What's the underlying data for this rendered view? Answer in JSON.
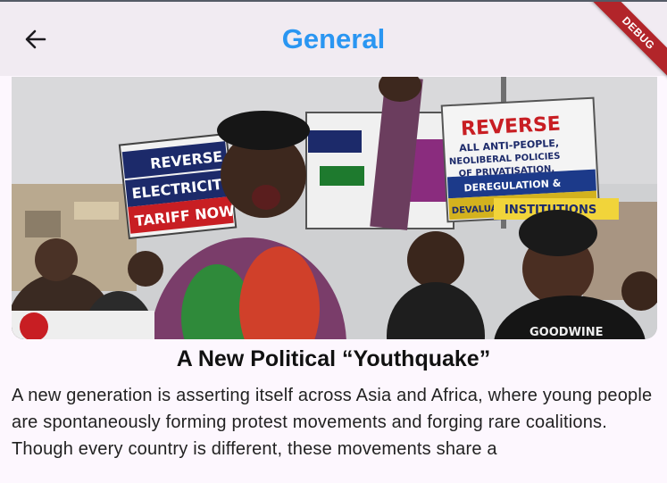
{
  "appbar": {
    "title": "General",
    "back_icon": "arrow-back-icon",
    "debug_label": "DEBUG"
  },
  "hero": {
    "signs": {
      "left": [
        "REVERSE",
        "ELECTRICITY",
        "TARIFF NOW"
      ],
      "right": [
        "REVERSE",
        "ALL ANTI-PEOPLE,",
        "NEOLIBERAL POLICIES",
        "OF PRIVATISATION,",
        "DEREGULATION &",
        "DEVALUATION OF NAIRA"
      ],
      "banner_right": "INSTITUTIONS",
      "shirt": "GOODWINE"
    }
  },
  "article": {
    "title": "A New Political “Youthquake”",
    "body": "A new generation is asserting itself across Asia and Africa, where young people are spontaneously forming protest movements and forging rare coalitions. Though every country is different, these movements share a"
  },
  "colors": {
    "title": "#2a96f2",
    "appbar_bg": "#f1ebf2",
    "page_bg": "#fdf7fe",
    "debug_ribbon": "#b2252a"
  }
}
